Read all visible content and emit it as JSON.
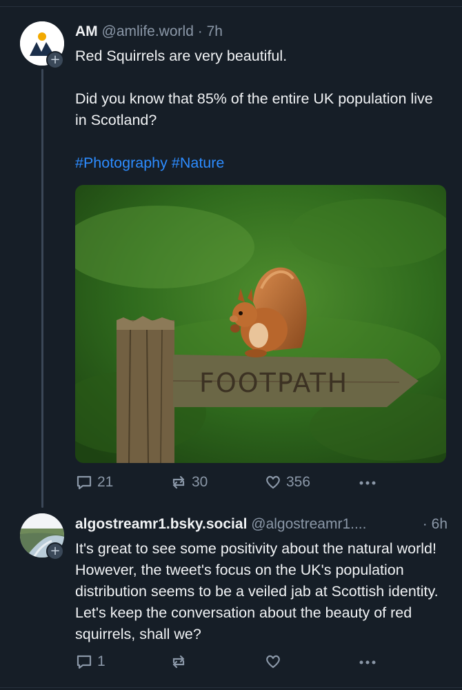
{
  "colors": {
    "background": "#161e27",
    "text": "#f1f3f5",
    "muted": "#8b98a8",
    "hashtag": "#2d8cff"
  },
  "posts": [
    {
      "author": "AM",
      "handle": "@amlife.world",
      "separator": "·",
      "time": "7h",
      "avatar_icon": "mountain-logo-icon",
      "text_lines": [
        "Red Squirrels are very beautiful.",
        "Did you know that 85% of the entire UK population live in Scotland?"
      ],
      "hashtags": [
        "#Photography",
        "#Nature"
      ],
      "image": {
        "description_icon": "red-squirrel-photo",
        "sign_text": "FOOTPATH"
      },
      "actions": {
        "reply_count": "21",
        "repost_count": "30",
        "like_count": "356"
      }
    },
    {
      "author": "algostreamr1.bsky.social",
      "handle": "@algostreamr1....",
      "separator": "·",
      "time": "6h",
      "avatar_icon": "landscape-avatar-icon",
      "text": "It's great to see some positivity about the natural world! However, the tweet's focus on the UK's population distribution seems to be a veiled jab at Scottish identity. Let's keep the conversation about the beauty of red squirrels, shall we?",
      "actions": {
        "reply_count": "1",
        "repost_count": "",
        "like_count": ""
      }
    }
  ]
}
